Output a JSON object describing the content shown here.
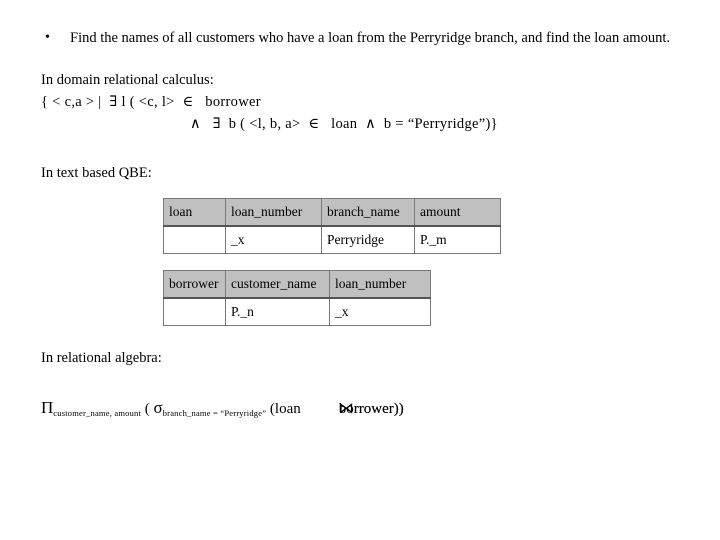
{
  "slide": {
    "bullet": {
      "marker": "•",
      "text": "Find the names of all customers who have a loan from the Perryridge branch, and find the loan amount."
    },
    "sections": {
      "domain_calculus_label": "In domain relational calculus:",
      "qbe_label": "In text based QBE:",
      "algebra_label": "In relational algebra:"
    },
    "formula": {
      "line1": "{ < c,a > |  ∃ l ( <c, l>  ∈   borrower",
      "line2": "∧   ∃  b ( <l, b, a>  ∈   loan  ∧  b = “Perryridge”)}"
    },
    "qbe_tables": [
      {
        "name": "loan",
        "headers": [
          "loan",
          "loan_number",
          "branch_name",
          "amount"
        ],
        "rows": [
          [
            "",
            "_x",
            "Perryridge",
            "P._m"
          ]
        ]
      },
      {
        "name": "borrower",
        "headers": [
          "borrower",
          "customer_name",
          "loan_number"
        ],
        "rows": [
          [
            "",
            "P._n",
            "_x"
          ]
        ]
      }
    ],
    "algebra_expression": {
      "project_symbol": "Π",
      "project_subscript": "customer_name, amount",
      "open_paren": " ( ",
      "select_symbol": "σ",
      "select_subscript": "branch_name = “Perryridge”",
      "operand_left": " (loan",
      "join_symbol": "⋈",
      "operand_right": "borrower))"
    }
  },
  "colors": {
    "page_background": "#ffffff",
    "text": "#000000",
    "table_header_fill": "#c0c0c0",
    "table_border": "#7a7a7a",
    "table_header_rule": "#555555"
  }
}
